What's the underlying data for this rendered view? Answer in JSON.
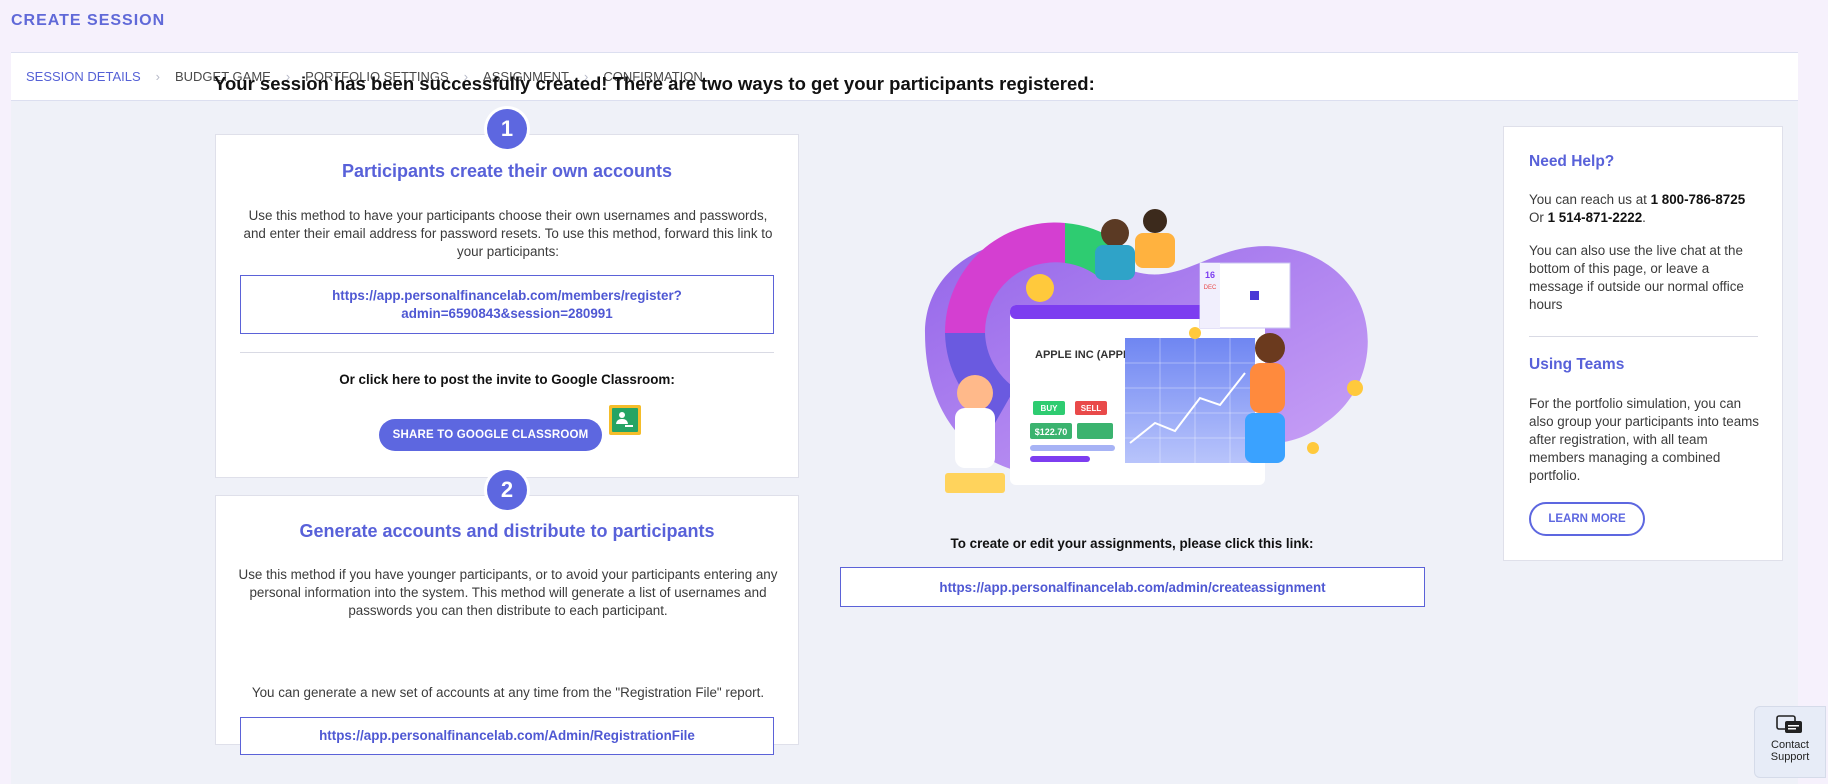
{
  "page": {
    "title": "CREATE SESSION"
  },
  "steps": [
    {
      "label": "SESSION DETAILS",
      "active": true
    },
    {
      "label": "BUDGET GAME",
      "active": false
    },
    {
      "label": "PORTFOLIO SETTINGS",
      "active": false
    },
    {
      "label": "ASSIGNMENT",
      "active": false
    },
    {
      "label": "CONFIRMATION",
      "active": false
    }
  ],
  "headline": "Your session has been successfully created! There are two ways to get your participants registered:",
  "option1": {
    "number": "1",
    "title": "Participants create their own accounts",
    "description": "Use this method to have your participants choose their own usernames and passwords, and enter their email address for password resets. To use this method, forward this link to your participants:",
    "link": "https://app.personalfinancelab.com/members/register?admin=6590843&session=280991",
    "classroom_label": "Or click here to post the invite to Google Classroom:",
    "share_button": "SHARE TO GOOGLE CLASSROOM"
  },
  "option2": {
    "number": "2",
    "title": "Generate accounts and distribute to participants",
    "description": "Use this method if you have younger participants, or to avoid your participants entering any personal information into the system. This method will generate a list of usernames and passwords you can then distribute to each participant.",
    "note": "You can generate a new set of accounts at any time from the \"Registration File\" report.",
    "link": "https://app.personalfinancelab.com/Admin/RegistrationFile"
  },
  "illustration": {
    "company": "APPLE INC (APPL)",
    "buy": "BUY",
    "sell": "SELL",
    "price": "$122.70",
    "calendar_day": "16",
    "calendar_month": "DEC"
  },
  "assignment": {
    "label": "To create or edit your assignments, please click this link:",
    "link": "https://app.personalfinancelab.com/admin/createassignment"
  },
  "help": {
    "title": "Need Help?",
    "reach_prefix": "You can reach us at ",
    "phone1": "1 800-786-8725",
    "or_prefix": "Or ",
    "phone2": "1 514-871-2222",
    "period": ".",
    "chat_text": "You can also use the live chat at the bottom of this page, or leave a message if outside our normal office hours",
    "teams_title": "Using Teams",
    "teams_text": "For the portfolio simulation, you can also group your participants into teams after registration, with all team members managing a combined portfolio.",
    "learn_more": "LEARN MORE"
  },
  "support": {
    "line1": "Contact",
    "line2": "Support"
  },
  "colors": {
    "accent": "#5d67e0",
    "link": "#4f58d3",
    "background": "#eff1f8"
  }
}
